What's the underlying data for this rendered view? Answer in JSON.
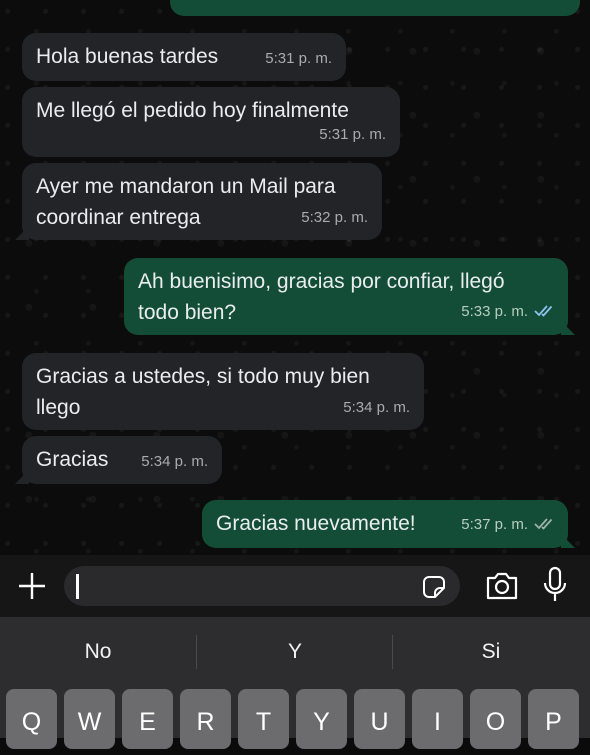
{
  "messages": [
    {
      "direction": "in",
      "text": "Hola buenas tardes",
      "time": "5:31 p. m."
    },
    {
      "direction": "in",
      "text": "Me llegó el pedido hoy finalmente",
      "time": "5:31 p. m."
    },
    {
      "direction": "in",
      "text": "Ayer me mandaron un Mail para\ncoordinar entrega",
      "time": "5:32 p. m."
    },
    {
      "direction": "out",
      "text": "Ah buenisimo, gracias por confiar, llegó\ntodo bien?",
      "time": "5:33 p. m.",
      "status": "read"
    },
    {
      "direction": "in",
      "text": "Gracias a ustedes, si todo muy bien\nllego",
      "time": "5:34 p. m."
    },
    {
      "direction": "in",
      "text": "Gracias",
      "time": "5:34 p. m."
    },
    {
      "direction": "out",
      "text": "Gracias nuevamente!",
      "time": "5:37 p. m.",
      "status": "delivered"
    }
  ],
  "composer": {
    "value": "",
    "icons": [
      "plus-icon",
      "sticker-icon",
      "camera-icon",
      "microphone-icon"
    ]
  },
  "suggestions": [
    "No",
    "Y",
    "Si"
  ],
  "keyboard_row": [
    "Q",
    "W",
    "E",
    "R",
    "T",
    "Y",
    "U",
    "I",
    "O",
    "P"
  ],
  "colors": {
    "incoming": "#232427",
    "outgoing": "#144d37",
    "read_tick": "#8fc3f0",
    "background": "#0b0b0b"
  }
}
